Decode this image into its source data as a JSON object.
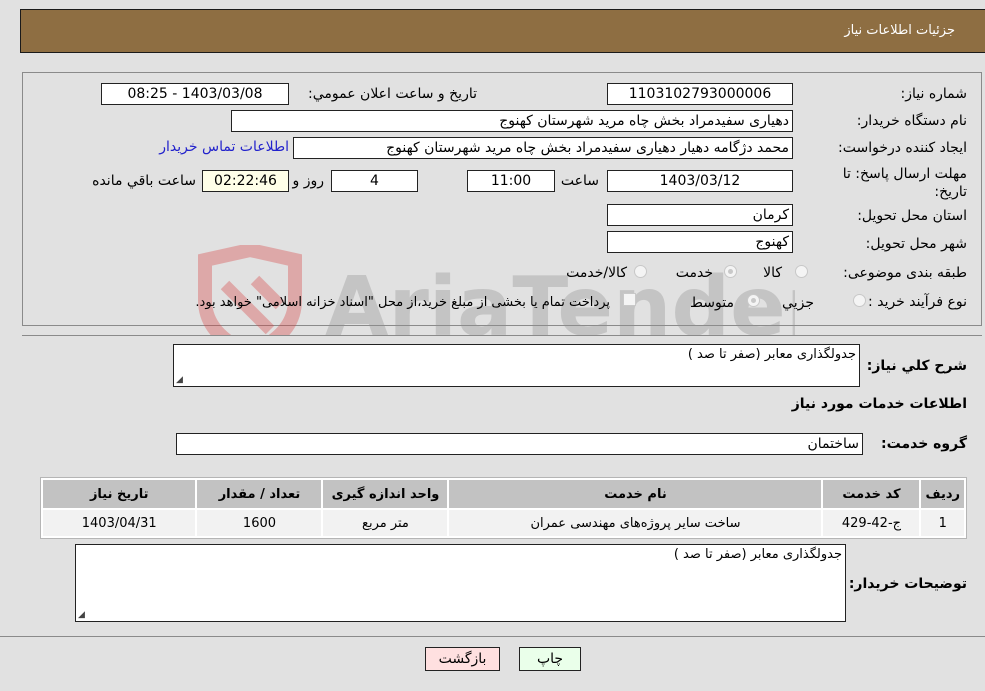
{
  "header": {
    "title": "جزئيات اطلاعات نياز"
  },
  "form": {
    "need_number": {
      "label": "شماره نياز:",
      "value": "1103102793000006"
    },
    "announce_datetime": {
      "label": "تاريخ و ساعت اعلان عمومي:",
      "value": "1403/03/08 - 08:25"
    },
    "buyer_org": {
      "label": "نام دستگاه خريدار:",
      "value": "دهیاری سفیدمراد بخش چاه مرید شهرستان کهنوج"
    },
    "requester": {
      "label": "ايجاد کننده درخواست:",
      "value": "محمد دژگامه دهیار دهیاری سفیدمراد بخش چاه مرید شهرستان کهنوج"
    },
    "buyer_contact_link": "اطلاعات تماس خريدار",
    "deadline": {
      "label": "مهلت ارسال پاسخ: تا تاريخ:",
      "date": "1403/03/12",
      "time_label": "ساعت",
      "time": "11:00",
      "days": "4",
      "days_label": "روز و",
      "remaining": "02:22:46",
      "remaining_label": "ساعت باقي مانده"
    },
    "province": {
      "label": "استان محل تحويل:",
      "value": "کرمان"
    },
    "city": {
      "label": "شهر محل تحويل:",
      "value": "کهنوج"
    },
    "category": {
      "label": "طبقه بندی موضوعی:",
      "options": [
        "کالا",
        "خدمت",
        "کالا/خدمت"
      ],
      "selected": "خدمت"
    },
    "purchase_type": {
      "label": "نوع فرآيند خريد :",
      "options": [
        "جزيي",
        "متوسط"
      ],
      "selected": "متوسط",
      "payment_note": "پرداخت تمام يا بخشی از مبلغ خريد،از محل \"اسناد خزانه اسلامی\" خواهد بود."
    }
  },
  "details": {
    "summary_label": "شرح کلي نياز:",
    "summary_value": "جدولگذاری معابر (صفر تا صد )",
    "services_heading": "اطلاعات خدمات مورد نياز",
    "service_group_label": "گروه خدمت:",
    "service_group_value": "ساختمان",
    "table": {
      "headers": [
        "رديف",
        "کد خدمت",
        "نام خدمت",
        "واحد اندازه گيری",
        "تعداد / مقدار",
        "تاريخ نياز"
      ],
      "rows": [
        [
          "1",
          "ج-42-429",
          "ساخت سایر پروژه‌های مهندسی عمران",
          "متر مربع",
          "1600",
          "1403/04/31"
        ]
      ]
    },
    "buyer_notes_label": "توضيحات خريدار:",
    "buyer_notes_value": "جدولگذاری معابر (صفر تا صد )"
  },
  "buttons": {
    "print": "چاپ",
    "back": "بازگشت"
  },
  "watermark": "AriaTender.neT"
}
